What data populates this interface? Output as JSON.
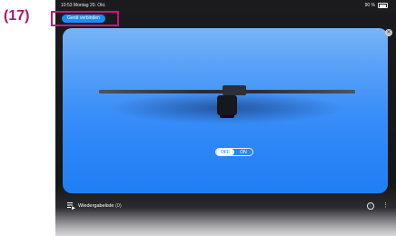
{
  "callout": {
    "number": "(17)"
  },
  "status_bar": {
    "time": "10:53 Montag 20. Okt.",
    "battery": "90 %"
  },
  "header": {
    "connect_button": "Gerät verbinden"
  },
  "toggle": {
    "off_label": "OFF",
    "on_label": "ON",
    "state": "off"
  },
  "playlist": {
    "label": "Wiedergabeliste",
    "count": "(0)"
  },
  "colors": {
    "accent": "#1e8cf5",
    "callout": "#c2187b",
    "card_blue": "#2c86f7"
  },
  "icons": [
    "close-icon",
    "playlist-icon",
    "info-icon",
    "more-icon",
    "battery-icon"
  ]
}
